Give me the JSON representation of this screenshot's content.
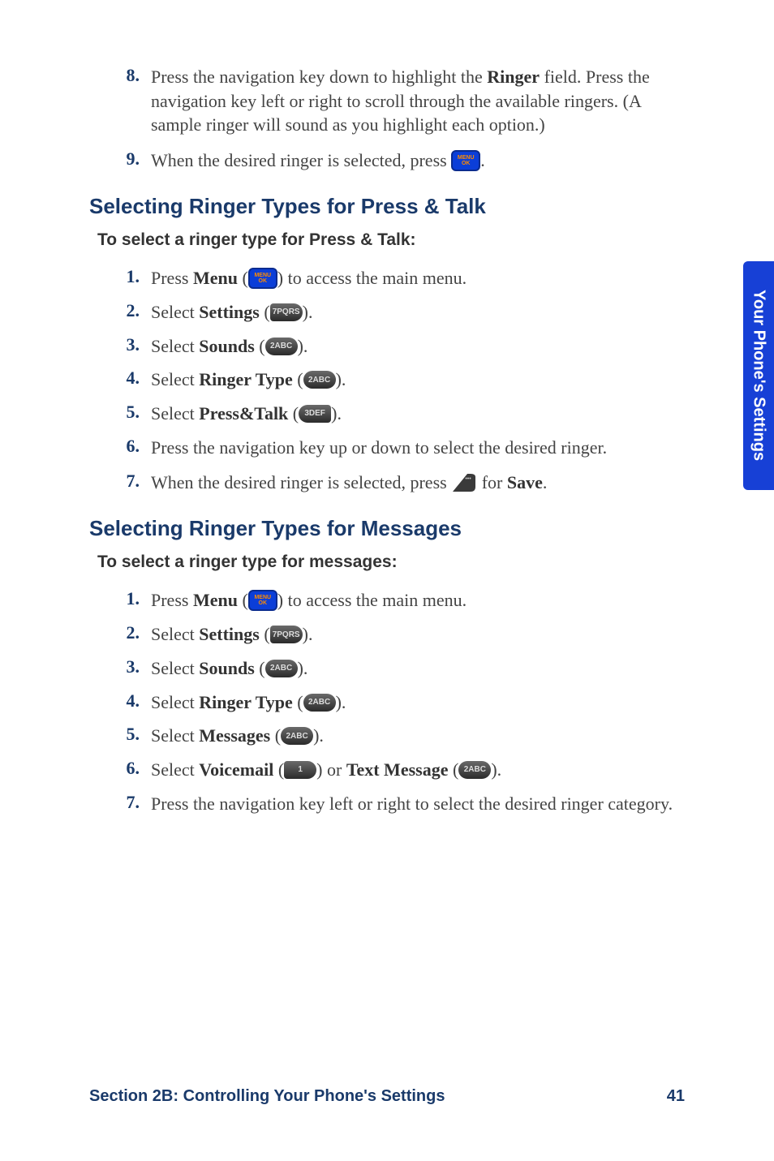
{
  "sideTab": "Your Phone's Settings",
  "topSteps": {
    "s8": {
      "num": "8.",
      "text_a": "Press the navigation key down to highlight the ",
      "bold_a": "Ringer",
      "text_b": " field. Press the navigation key left or right to scroll through the available ringers. (A sample ringer will sound as you highlight each option.)"
    },
    "s9": {
      "num": "9.",
      "text_a": "When the desired ringer is selected, press ",
      "text_b": "."
    }
  },
  "sectionA": {
    "heading": "Selecting Ringer Types for Press & Talk",
    "lead": "To select a ringer type for Press & Talk:",
    "s1": {
      "num": "1.",
      "a": "Press ",
      "bold": "Menu",
      "b": " (",
      "c": ") to access the main menu."
    },
    "s2": {
      "num": "2.",
      "a": "Select ",
      "bold": "Settings",
      "b": " (",
      "c": ")."
    },
    "s3": {
      "num": "3.",
      "a": "Select ",
      "bold": "Sounds",
      "b": " (",
      "c": ")."
    },
    "s4": {
      "num": "4.",
      "a": "Select ",
      "bold": "Ringer Type",
      "b": " (",
      "c": ")."
    },
    "s5": {
      "num": "5.",
      "a": "Select ",
      "bold": "Press&Talk",
      "b": " (",
      "c": ")."
    },
    "s6": {
      "num": "6.",
      "a": "Press the navigation key up or down to select the desired ringer."
    },
    "s7": {
      "num": "7.",
      "a": "When the desired ringer is selected, press ",
      "b": " for ",
      "bold": "Save",
      "c": "."
    }
  },
  "sectionB": {
    "heading": "Selecting Ringer Types for Messages",
    "lead": "To select a ringer type for messages:",
    "s1": {
      "num": "1.",
      "a": "Press ",
      "bold": "Menu",
      "b": " (",
      "c": ") to access the main menu."
    },
    "s2": {
      "num": "2.",
      "a": "Select ",
      "bold": "Settings",
      "b": " (",
      "c": ")."
    },
    "s3": {
      "num": "3.",
      "a": "Select ",
      "bold": "Sounds",
      "b": " (",
      "c": ")."
    },
    "s4": {
      "num": "4.",
      "a": "Select ",
      "bold": "Ringer Type",
      "b": " (",
      "c": ")."
    },
    "s5": {
      "num": "5.",
      "a": "Select ",
      "bold": "Messages",
      "b": " (",
      "c": ")."
    },
    "s6": {
      "num": "6.",
      "a": "Select ",
      "bold1": "Voicemail",
      "b": " (",
      "c": ") or ",
      "bold2": "Text Message",
      "d": " (",
      "e": ")."
    },
    "s7": {
      "num": "7.",
      "a": "Press the navigation key left or right to select the desired ringer category."
    }
  },
  "footer": {
    "left": "Section 2B: Controlling Your Phone's Settings",
    "right": "41"
  },
  "keycaps": {
    "menuok_top": "MENU",
    "menuok_bottom": "OK",
    "k7": "7PQRS",
    "k2": "2ABC",
    "k3": "3DEF",
    "k1": "1",
    "softdots": "•••"
  }
}
